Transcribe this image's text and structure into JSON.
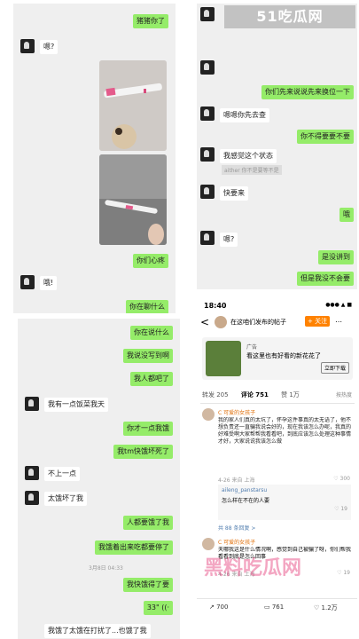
{
  "watermark": {
    "site": "51吃瓜网",
    "site_bottom": "黑料吃瓜网"
  },
  "p1": {
    "m1": "猪猪你了",
    "m2": "嗯?",
    "m3": "你们心疼",
    "m4": "哦!",
    "m5": "你在聊什么"
  },
  "p2": {
    "m1": "你们先来说说先来换位一下",
    "m2": "嗯嗯你先去查",
    "m3": "你不得要要不要",
    "m4": "我感觉这个状态",
    "sys": "aither 你不是要等不是",
    "m5": "快要来",
    "m6": "哦",
    "m7": "嗯?",
    "m8": "是没讲到",
    "m9": "但是我没不会要"
  },
  "p3": {
    "m1": "你在说什么",
    "m2": "我说没写到啊",
    "m3": "我人都吧了",
    "m4": "我有一点饭菜我天",
    "m5": "你才一点我饿",
    "m6": "我tm快饿坏死了",
    "m7": "不上一点",
    "m8": "太饿坏了我",
    "m9": "人都要饿了我",
    "m10": "我饿着出来吃都要停了",
    "time": "3月8日 04:33",
    "m11": "我快饿得了要",
    "m12": "33\" ((·",
    "m13": "我饿了太饿在打扰了...也饿了我"
  },
  "p4": {
    "status_time": "18:40",
    "status_icons": "●●● ▲ ■",
    "back": "<",
    "user_name": "在这咱们发布的帖子",
    "follow": "+ 关注",
    "ad_label": "广告",
    "ad_text": "看这里也有好看的新花花了",
    "ad_btn": "立即下载",
    "tabs": [
      "转发 205",
      "评论 751",
      "赞 1万"
    ],
    "sort": "按热度",
    "c1_name": "C 可爱的女孩子",
    "c1_text": "我的家人们真的太坑了，怀孕这件事真的太无语了，他不想负责还一直骗我说会好的，现在我该怎么办呢，我真的好难受啊大家帮帮我看看吧，到底应该怎么处理这种事情才好，大家说说我该怎么做",
    "c1_meta": "4-26 来自 上海",
    "c1_likes": "♡ 300",
    "reply_name": "aileng_panstarsu",
    "reply_text": "怎么样在不在的人要",
    "reply_likes": "♡ 19",
    "more_replies": "共 88 条回复 >",
    "c2_name": "C 可爱的女孩子",
    "c2_text": "天哪我这是什么情况啊，感觉到自己被骗了呀，你们帮我看看到底是怎么回事",
    "c2_meta": "4-26 来自 上海",
    "c2_likes": "♡ 19",
    "bottom": {
      "share": "700",
      "comment": "761",
      "like": "1.2万"
    }
  }
}
